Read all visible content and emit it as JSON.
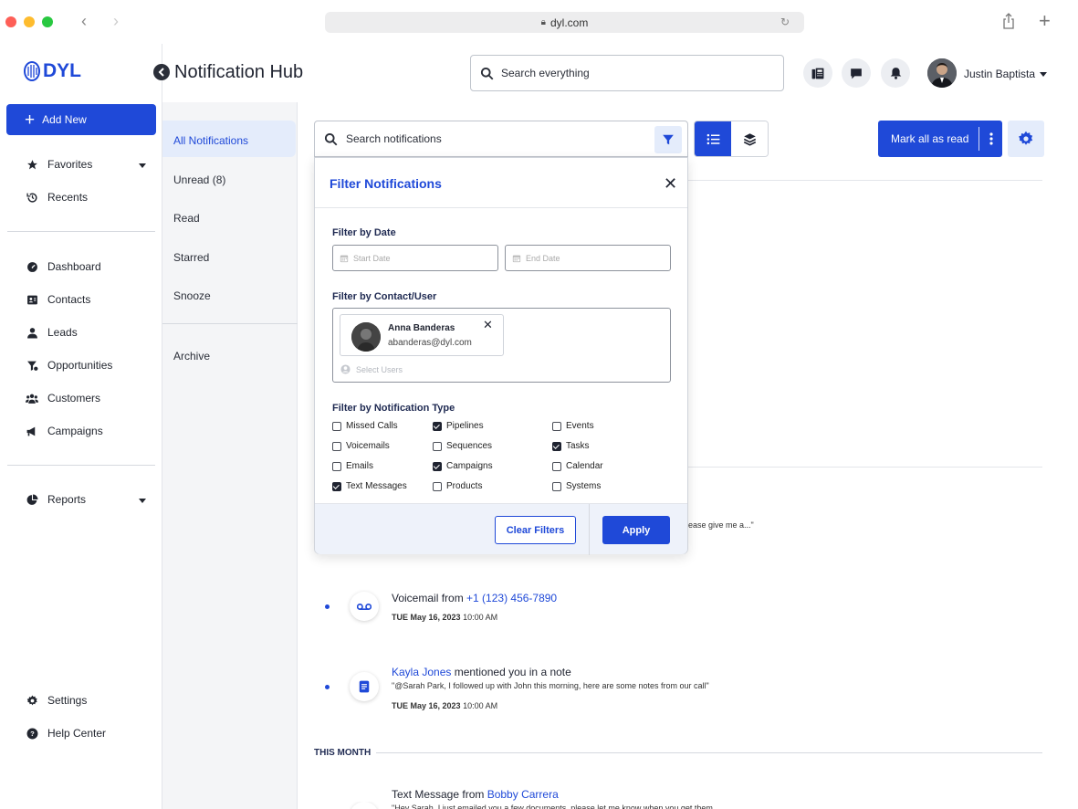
{
  "browser": {
    "url": "dyl.com"
  },
  "brand": {
    "logo_text": "DYL",
    "accent": "#1f49d8"
  },
  "header": {
    "title": "Notification Hub",
    "search_placeholder": "Search everything",
    "user_name": "Justin Baptista"
  },
  "sidebar": {
    "add_new": "Add New",
    "top_items": [
      {
        "label": "Favorites",
        "icon": "star-icon"
      },
      {
        "label": "Recents",
        "icon": "history-icon"
      }
    ],
    "main_items": [
      {
        "label": "Dashboard",
        "icon": "dashboard-icon"
      },
      {
        "label": "Contacts",
        "icon": "contact-card-icon"
      },
      {
        "label": "Leads",
        "icon": "person-icon"
      },
      {
        "label": "Opportunities",
        "icon": "funnel-icon"
      },
      {
        "label": "Customers",
        "icon": "group-icon"
      },
      {
        "label": "Campaigns",
        "icon": "megaphone-icon"
      }
    ],
    "reports": "Reports",
    "settings": "Settings",
    "help": "Help Center"
  },
  "subnav": {
    "items": [
      "All Notifications",
      "Unread (8)",
      "Read",
      "Starred",
      "Snooze"
    ],
    "archive": "Archive"
  },
  "toolbar": {
    "search_placeholder": "Search notifications",
    "mark_all": "Mark all as read"
  },
  "filter": {
    "title": "Filter Notifications",
    "date_label": "Filter by Date",
    "start_placeholder": "Start Date",
    "end_placeholder": "End Date",
    "contact_label": "Filter by Contact/User",
    "chip_name": "Anna Banderas",
    "chip_email": "abanderas@dyl.com",
    "select_users": "Select Users",
    "type_label": "Filter by Notification Type",
    "types": [
      {
        "label": "Missed Calls",
        "checked": false
      },
      {
        "label": "Pipelines",
        "checked": true
      },
      {
        "label": "Events",
        "checked": false
      },
      {
        "label": "Voicemails",
        "checked": false
      },
      {
        "label": "Sequences",
        "checked": false
      },
      {
        "label": "Tasks",
        "checked": true
      },
      {
        "label": "Emails",
        "checked": false
      },
      {
        "label": "Campaigns",
        "checked": true
      },
      {
        "label": "Calendar",
        "checked": false
      },
      {
        "label": "Text Messages",
        "checked": true
      },
      {
        "label": "Products",
        "checked": false
      },
      {
        "label": "Systems",
        "checked": false
      }
    ],
    "clear": "Clear Filters",
    "apply": "Apply"
  },
  "feed": {
    "partial_text": "ease give me a...\"",
    "voicemail": {
      "prefix": "Voicemail from ",
      "number": "+1 (123) 456-7890",
      "day": "TUE May 16, 2023",
      "time": "10:00 AM"
    },
    "mention": {
      "name": "Kayla Jones",
      "suffix": " mentioned you in a note",
      "quote": "\"@Sarah Park, I followed up with John this morning, here are some notes from our call\"",
      "day": "TUE May 16, 2023",
      "time": "10:00 AM"
    },
    "section": "THIS MONTH",
    "text_msg": {
      "prefix": "Text Message from ",
      "name": "Bobby Carrera",
      "quote": "\"Hey Sarah, I just emailed you a few documents, please let me know when you get them"
    }
  }
}
